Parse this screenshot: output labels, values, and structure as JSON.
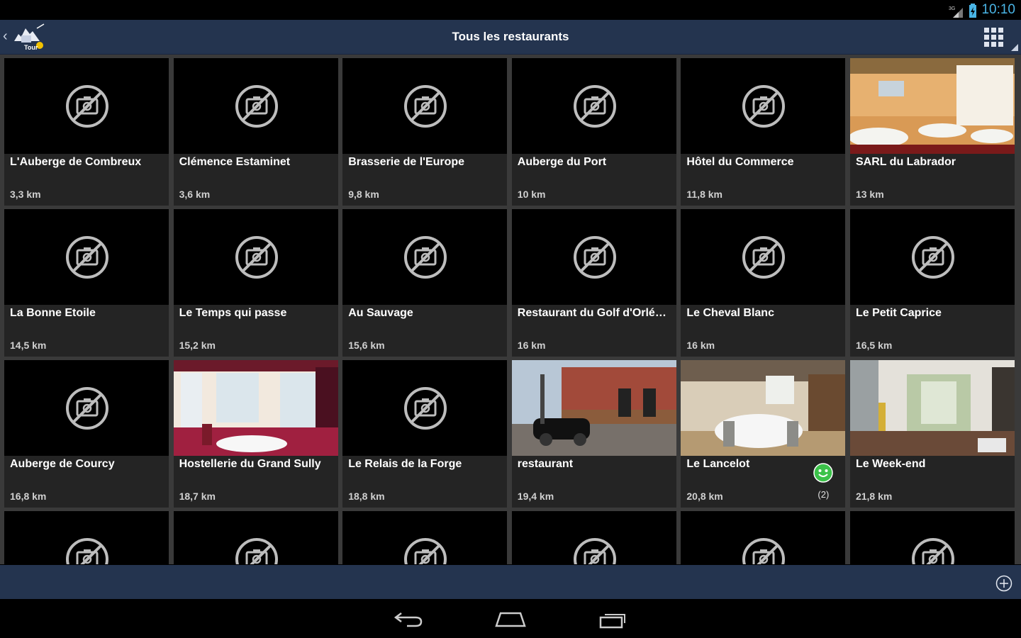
{
  "status_bar": {
    "time": "10:10",
    "network": "3G"
  },
  "action_bar": {
    "title": "Tous les restaurants",
    "logo_text": "Tour"
  },
  "restaurants": [
    {
      "name": "L'Auberge de Combreux",
      "distance": "3,3 km",
      "photo": null
    },
    {
      "name": "Clémence Estaminet",
      "distance": "3,6 km",
      "photo": null
    },
    {
      "name": "Brasserie de l'Europe",
      "distance": "9,8 km",
      "photo": null
    },
    {
      "name": "Auberge du Port",
      "distance": "10 km",
      "photo": null
    },
    {
      "name": "Hôtel du Commerce",
      "distance": "11,8 km",
      "photo": null
    },
    {
      "name": "SARL du Labrador",
      "distance": "13 km",
      "photo": "dining-room"
    },
    {
      "name": "La Bonne Etoile",
      "distance": "14,5 km",
      "photo": null
    },
    {
      "name": "Le Temps qui passe",
      "distance": "15,2 km",
      "photo": null
    },
    {
      "name": "Au Sauvage",
      "distance": "15,6 km",
      "photo": null
    },
    {
      "name": "Restaurant du Golf d'Orléa…",
      "distance": "16 km",
      "photo": null
    },
    {
      "name": "Le Cheval Blanc",
      "distance": "16 km",
      "photo": null
    },
    {
      "name": "Le Petit Caprice",
      "distance": "16,5 km",
      "photo": null
    },
    {
      "name": "Auberge de Courcy",
      "distance": "16,8 km",
      "photo": null
    },
    {
      "name": "Hostellerie du Grand Sully",
      "distance": "18,7 km",
      "photo": "dining-room-red"
    },
    {
      "name": "Le Relais de la Forge",
      "distance": "18,8 km",
      "photo": null
    },
    {
      "name": "restaurant",
      "distance": "19,4 km",
      "photo": "street-car"
    },
    {
      "name": "Le Lancelot",
      "distance": "20,8 km",
      "photo": "banquet-room",
      "rating": {
        "icon": "smiley-icon",
        "count": "(2)"
      }
    },
    {
      "name": "Le Week-end",
      "distance": "21,8 km",
      "photo": "lounge"
    },
    {
      "name": "",
      "distance": "",
      "photo": null
    },
    {
      "name": "",
      "distance": "",
      "photo": null
    },
    {
      "name": "",
      "distance": "",
      "photo": null
    },
    {
      "name": "",
      "distance": "",
      "photo": null
    },
    {
      "name": "",
      "distance": "",
      "photo": null
    },
    {
      "name": "",
      "distance": "",
      "photo": null
    }
  ],
  "colors": {
    "bar": "#24344f",
    "tile": "#242424",
    "smiley": "#3cc24a",
    "clock": "#4ab5e6"
  }
}
